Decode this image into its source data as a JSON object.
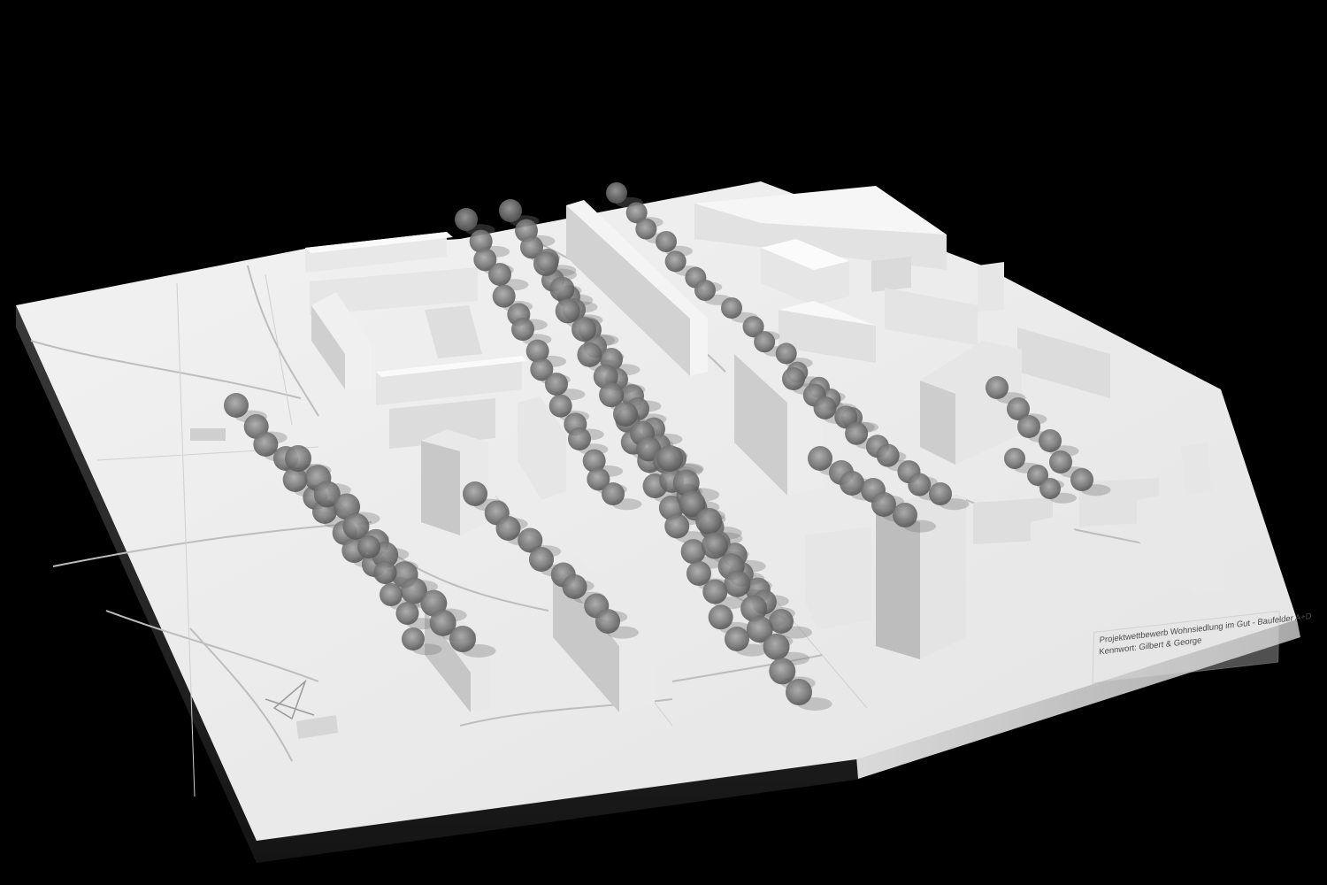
{
  "photo": {
    "background": "#000000",
    "model_color": "#ececec",
    "shadow_color": "#8a8a8a"
  },
  "label": {
    "line1": "Projektwettbewerb Wohnsiedlung im Gut - Baufelder A+D",
    "line2": "Kennwort: Gilbert & George"
  }
}
